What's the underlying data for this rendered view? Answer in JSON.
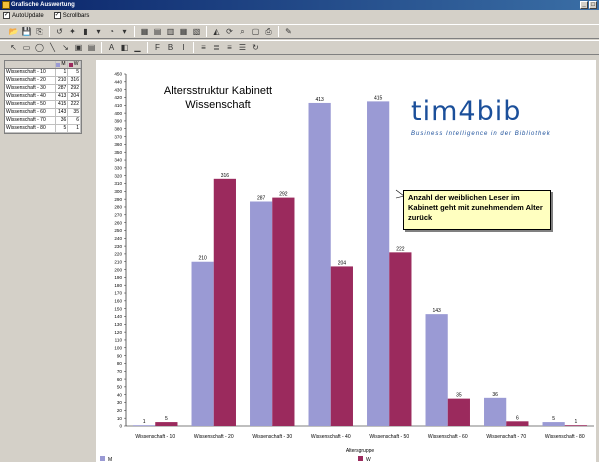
{
  "window": {
    "title": "Grafische Auswertung",
    "buttons": [
      "_",
      "□"
    ]
  },
  "options": {
    "autoupdate_label": "AutoUpdate",
    "autoupdate_checked": true,
    "scrollbars_label": "Scrollbars",
    "scrollbars_checked": true
  },
  "toolbar1": [
    "open-icon",
    "save-icon",
    "copy-icon",
    "undo-icon",
    "chart-wizard-icon",
    "chart-type-icon",
    "dropdown-icon",
    "gallery-icon",
    "dropdown-icon",
    "datagrid-icon",
    "legend-icon",
    "series-legend-icon",
    "table-icon",
    "chart-options-icon",
    "3d-icon",
    "rotate-icon",
    "zoom-icon",
    "print-preview-icon",
    "print-icon",
    "tools-icon"
  ],
  "toolbar2": [
    "pointer-icon",
    "rectangle-icon",
    "ellipse-icon",
    "line-icon",
    "arrow-icon",
    "image-icon",
    "picture-icon",
    "text-icon",
    "fill-color-icon",
    "line-color-icon",
    "font-icon",
    "bold-icon",
    "italic-icon",
    "align-left-icon",
    "align-center-icon",
    "align-right-icon",
    "justify-icon",
    "rotate-text-icon"
  ],
  "datagrid": {
    "headers": [
      "",
      "M",
      "W"
    ],
    "rows": [
      {
        "label": "Wissenschaft - 10",
        "m": "1",
        "w": "5"
      },
      {
        "label": "Wissenschaft - 20",
        "m": "210",
        "w": "316"
      },
      {
        "label": "Wissenschaft - 30",
        "m": "287",
        "w": "292"
      },
      {
        "label": "Wissenschaft - 40",
        "m": "413",
        "w": "204"
      },
      {
        "label": "Wissenschaft - 50",
        "m": "415",
        "w": "222"
      },
      {
        "label": "Wissenschaft - 60",
        "m": "143",
        "w": "35"
      },
      {
        "label": "Wissenschaft - 70",
        "m": "36",
        "w": "6"
      },
      {
        "label": "Wissenschaft - 80",
        "m": "5",
        "w": "1"
      }
    ]
  },
  "chart_data": {
    "type": "bar",
    "title": "Altersstruktur Kabinett Wissenschaft",
    "xlabel": "Altersgruppe",
    "ylabel": "",
    "ylim": [
      0,
      450
    ],
    "ytick_step": 10,
    "categories": [
      "Wissenschaft - 10",
      "Wissenschaft - 20",
      "Wissenschaft - 30",
      "Wissenschaft - 40",
      "Wissenschaft - 50",
      "Wissenschaft - 60",
      "Wissenschaft - 70",
      "Wissenschaft - 80"
    ],
    "series": [
      {
        "name": "M",
        "color": "#9a9ad4",
        "values": [
          1,
          210,
          287,
          413,
          415,
          143,
          36,
          5
        ]
      },
      {
        "name": "W",
        "color": "#9b2a5d",
        "values": [
          5,
          316,
          292,
          204,
          222,
          35,
          6,
          1
        ]
      }
    ],
    "legend_placement": "bottom",
    "annotation": "Anzahl der weiblichen Leser im Kabinett geht mit zunehmendem Alter zurück"
  },
  "logo": {
    "main": "tim4bib",
    "sub": "Business Intelligence in der Bibliothek"
  },
  "colors": {
    "series_m": "#9a9ad4",
    "series_w": "#9b2a5d",
    "titlebar": "#0a246a",
    "callout": "#ffffc0"
  }
}
